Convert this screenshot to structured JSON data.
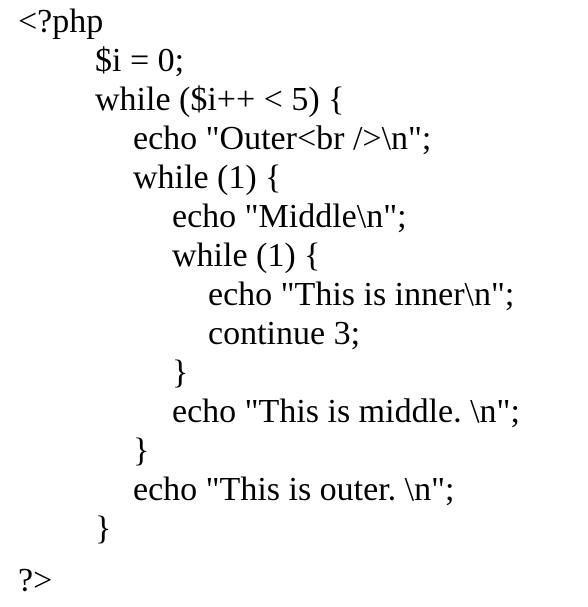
{
  "code": {
    "lines": [
      "<?php",
      "$i = 0;",
      "while ($i++ < 5) {",
      "echo \"Outer<br />\\n\";",
      "while (1) {",
      "echo \"Middle\\n\";",
      "while (1) {",
      "echo \"This is inner\\n\";",
      "continue 3;",
      "}",
      "echo \"This is middle. \\n\";",
      "}",
      "echo \"This is outer. \\n\";",
      "}",
      "?>"
    ]
  }
}
